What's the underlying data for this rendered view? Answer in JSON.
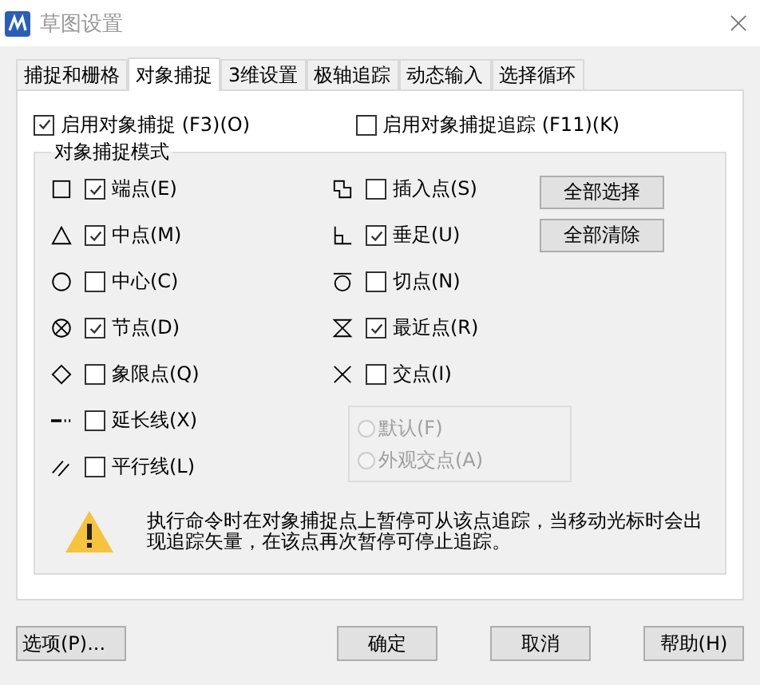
{
  "window": {
    "title": "草图设置"
  },
  "tabs": [
    {
      "label": "捕捉和栅格",
      "selected": false
    },
    {
      "label": "对象捕捉",
      "selected": true
    },
    {
      "label": "3维设置",
      "selected": false
    },
    {
      "label": "极轴追踪",
      "selected": false
    },
    {
      "label": "动态输入",
      "selected": false
    },
    {
      "label": "选择循环",
      "selected": false
    }
  ],
  "enable_snap": {
    "label": "启用对象捕捉 (F3)(O)",
    "checked": true
  },
  "enable_tracking": {
    "label": "启用对象捕捉追踪 (F11)(K)",
    "checked": false
  },
  "snap_modes": {
    "title": "对象捕捉模式",
    "left": [
      {
        "kind": "square",
        "label": "端点(E)",
        "checked": true
      },
      {
        "kind": "triangle",
        "label": "中点(M)",
        "checked": true
      },
      {
        "kind": "circle",
        "label": "中心(C)",
        "checked": false
      },
      {
        "kind": "node",
        "label": "节点(D)",
        "checked": true
      },
      {
        "kind": "diamond",
        "label": "象限点(Q)",
        "checked": false
      },
      {
        "kind": "extension",
        "label": "延长线(X)",
        "checked": false
      },
      {
        "kind": "parallel",
        "label": "平行线(L)",
        "checked": false
      }
    ],
    "right": [
      {
        "kind": "insertion",
        "label": "插入点(S)",
        "checked": false
      },
      {
        "kind": "perpendicular",
        "label": "垂足(U)",
        "checked": true
      },
      {
        "kind": "tangent",
        "label": "切点(N)",
        "checked": false
      },
      {
        "kind": "nearest",
        "label": "最近点(R)",
        "checked": true
      },
      {
        "kind": "intersection",
        "label": "交点(I)",
        "checked": false
      }
    ],
    "radios": [
      {
        "label": "默认(F)",
        "selected": false,
        "disabled": true
      },
      {
        "label": "外观交点(A)",
        "selected": false,
        "disabled": true
      }
    ],
    "buttons": [
      "全部选择",
      "全部清除"
    ],
    "note": "执行命令时在对象捕捉点上暂停可从该点追踪，当移动光标时会出现追踪矢量，在该点再次暂停可停止追踪。"
  },
  "footer": {
    "options": "选项(P)...",
    "buttons": [
      "确定",
      "取消",
      "帮助(H)"
    ]
  }
}
